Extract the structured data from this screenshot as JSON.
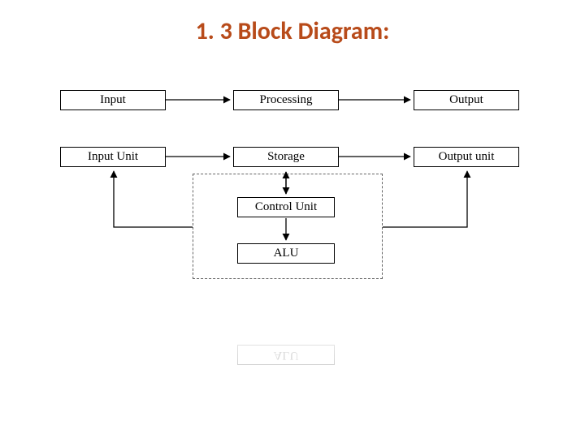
{
  "title": "1. 3 Block Diagram:",
  "blocks": {
    "input": "Input",
    "processing": "Processing",
    "output": "Output",
    "input_unit": "Input Unit",
    "storage": "Storage",
    "output_unit": "Output unit",
    "control_unit": "Control Unit",
    "alu": "ALU"
  },
  "reflection": {
    "alu": "ALU"
  }
}
